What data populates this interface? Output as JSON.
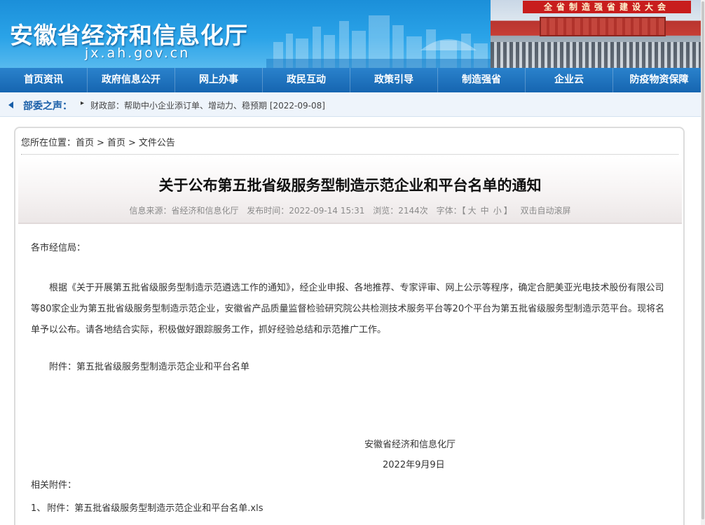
{
  "header": {
    "site_title": "安徽省经济和信息化厅",
    "site_domain": "jx.ah.gov.cn",
    "banner_slogan": "全省制造强省建设大会"
  },
  "nav": {
    "items": [
      {
        "label": "首页资讯"
      },
      {
        "label": "政府信息公开"
      },
      {
        "label": "网上办事"
      },
      {
        "label": "政民互动"
      },
      {
        "label": "政策引导"
      },
      {
        "label": "制造强省"
      },
      {
        "label": "企业云"
      },
      {
        "label": "防疫物资保障"
      }
    ]
  },
  "ticker": {
    "label": "部委之声：",
    "arrow": "▸",
    "link_text": "财政部：帮助中小企业添订单、增动力、稳预期 [2022-09-08]"
  },
  "breadcrumb": {
    "prefix": "您所在位置：",
    "items": [
      "首页",
      "首页",
      "文件公告"
    ],
    "separator": ">"
  },
  "article": {
    "title": "关于公布第五批省级服务型制造示范企业和平台名单的通知",
    "meta": {
      "source": "信息来源：省经济和信息化厅",
      "time": "发布时间：2022-09-14 15:31",
      "views": "浏览：2144次",
      "font_label": "字体：",
      "font_open": "【",
      "font_large": "大",
      "font_medium": "中",
      "font_small": "小",
      "font_close": "】",
      "autoscroll": "双击自动滚屏"
    },
    "salutation": "各市经信局：",
    "paragraph": "根据《关于开展第五批省级服务型制造示范遴选工作的通知》，经企业申报、各地推荐、专家评审、网上公示等程序，确定合肥美亚光电技术股份有限公司等80家企业为第五批省级服务型制造示范企业，安徽省产品质量监督检验研究院公共检测技术服务平台等20个平台为第五批省级服务型制造示范平台。现将名单予以公布。请各地结合实际，积极做好跟踪服务工作，抓好经验总结和示范推广工作。",
    "attachment_line": "附件：第五批省级服务型制造示范企业和平台名单",
    "signature_org": "安徽省经济和信息化厅",
    "signature_date": "2022年9月9日",
    "related_label": "相关附件：",
    "related_files": [
      {
        "index": "1、",
        "name": "附件：第五批省级服务型制造示范企业和平台名单.xls"
      }
    ]
  },
  "colors": {
    "banner_blue": "#2aa3e8",
    "nav_blue": "#1665b0",
    "ticker_label": "#1a5fa8",
    "slogan_red": "#c81d1d"
  }
}
